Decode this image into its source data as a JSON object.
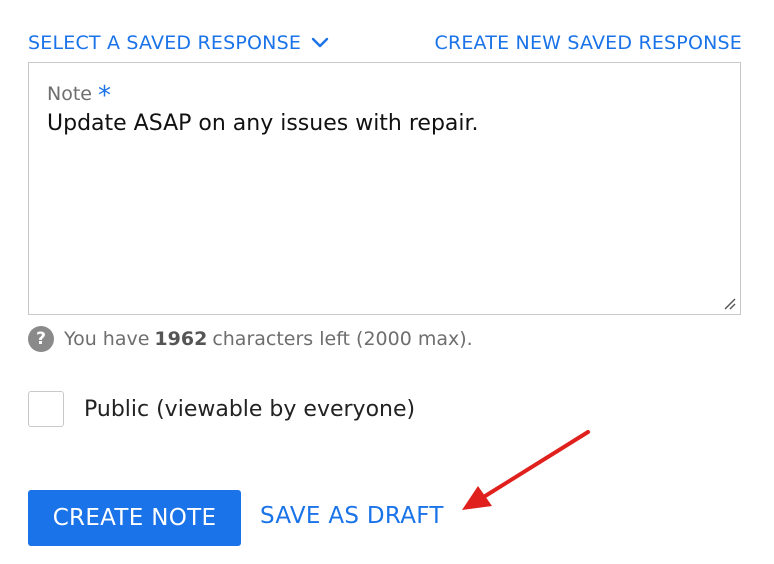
{
  "top_links": {
    "select_saved": "SELECT A SAVED RESPONSE",
    "create_saved": "CREATE NEW SAVED RESPONSE"
  },
  "note": {
    "label": "Note",
    "required_marker": "*",
    "value": "Update ASAP on any issues with repair."
  },
  "help": {
    "icon": "?",
    "prefix": "You have",
    "count": "1962",
    "suffix": "characters left (2000 max)."
  },
  "public_checkbox": {
    "label": "Public (viewable by everyone)",
    "checked": false
  },
  "actions": {
    "create_label": "CREATE NOTE",
    "draft_label": "SAVE AS DRAFT"
  },
  "colors": {
    "accent": "#1a73e8",
    "annotation_arrow": "#e0201c"
  }
}
